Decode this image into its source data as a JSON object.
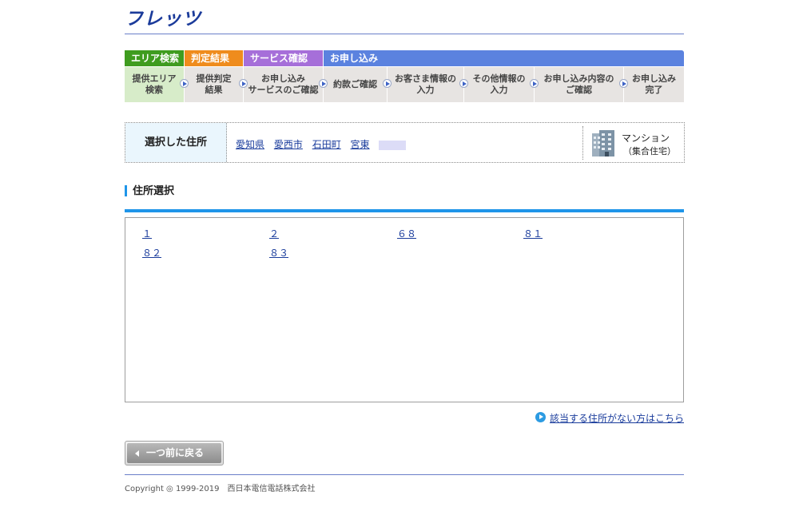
{
  "header": {
    "logo_text": "フレッツ"
  },
  "steps": {
    "categories": {
      "area": "エリア検索",
      "judge": "判定結果",
      "service": "サービス確認",
      "apply": "お申し込み"
    },
    "items": [
      {
        "label": "提供エリア\n検索"
      },
      {
        "label": "提供判定\n結果"
      },
      {
        "label": "お申し込み\nサービスのご確認"
      },
      {
        "label": "約款ご確認"
      },
      {
        "label": "お客さま情報の\n入力"
      },
      {
        "label": "その他情報の\n入力"
      },
      {
        "label": "お申し込み内容の\nご確認"
      },
      {
        "label": "お申し込み\n完了"
      }
    ]
  },
  "selected_address": {
    "label": "選択した住所",
    "parts": [
      "愛知県",
      "愛西市",
      "石田町",
      "宮東"
    ],
    "building_type": "マンション",
    "building_sub": "（集合住宅）"
  },
  "section": {
    "title": "住所選択"
  },
  "address_options": [
    "１",
    "２",
    "６８",
    "８１",
    "８２",
    "８３"
  ],
  "help_link": "該当する住所がない方はこちら",
  "back_button": "一つ前に戻る",
  "footer": {
    "copyright": "Copyright ◎ 1999-2019　西日本電信電話株式会社"
  },
  "colors": {
    "brand": "#1b3b9a",
    "area": "#3f9c1f",
    "judge": "#ef8c1d",
    "service": "#a66fd9",
    "apply": "#5b82df",
    "accent": "#1f95e9"
  }
}
